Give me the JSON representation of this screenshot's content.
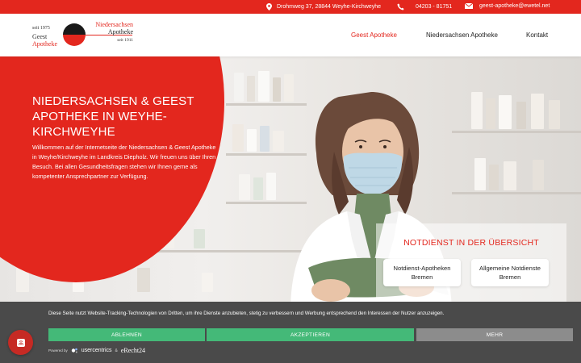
{
  "colors": {
    "brand_red": "#e3271e",
    "cookie_bg": "#4a4a4a",
    "accept_green": "#44b978",
    "more_grey": "#8c8c8c"
  },
  "topbar": {
    "address": "Drohmweg 37, 28844 Weyhe-Kirchweyhe",
    "phone": "04203 - 81751",
    "email": "geest-apotheke@ewetel.net",
    "icons": [
      "map-pin-icon",
      "phone-icon",
      "envelope-icon"
    ]
  },
  "logo": {
    "left_since": "seit 1975",
    "left_name1": "Geest",
    "left_name2": "Apotheke",
    "right_name1": "Niedersachsen",
    "right_name2": "Apotheke",
    "right_since": "seit 1911"
  },
  "nav": [
    {
      "label": "Geest Apotheke",
      "active": true
    },
    {
      "label": "Niedersachsen Apotheke",
      "active": false
    },
    {
      "label": "Kontakt",
      "active": false
    }
  ],
  "hero": {
    "title": "NIEDERSACHSEN & GEEST APOTHEKE IN WEYHE-KIRCHWEYHE",
    "text": "Willkommen auf der Internetseite der Niedersachsen & Geest Apotheke in Weyhe/Kirchweyhe im Landkreis Diepholz. Wir freuen uns über Ihren Besuch. Bei allen Gesundheitsfragen stehen wir Ihnen gerne als kompetenter Ansprechpartner zur Verfügung."
  },
  "notdienst": {
    "title": "NOTDIENST IN DER ÜBERSICHT",
    "button1": "Notdienst-Apotheken Bremen",
    "button2": "Allgemeine Notdienste Bremen"
  },
  "cookie": {
    "text": "Diese Seite nutzt Website-Tracking-Technologien von Dritten, um ihre Dienste anzubieten, stetig zu verbessern und Werbung entsprechend den Interessen der Nutzer anzuzeigen.",
    "deny": "ABLEHNEN",
    "accept": "AKZEPTIEREN",
    "more": "MEHR",
    "powered_by": "Powered by",
    "brand1": "usercentrics",
    "amp": "&",
    "brand2": "eRecht24"
  }
}
